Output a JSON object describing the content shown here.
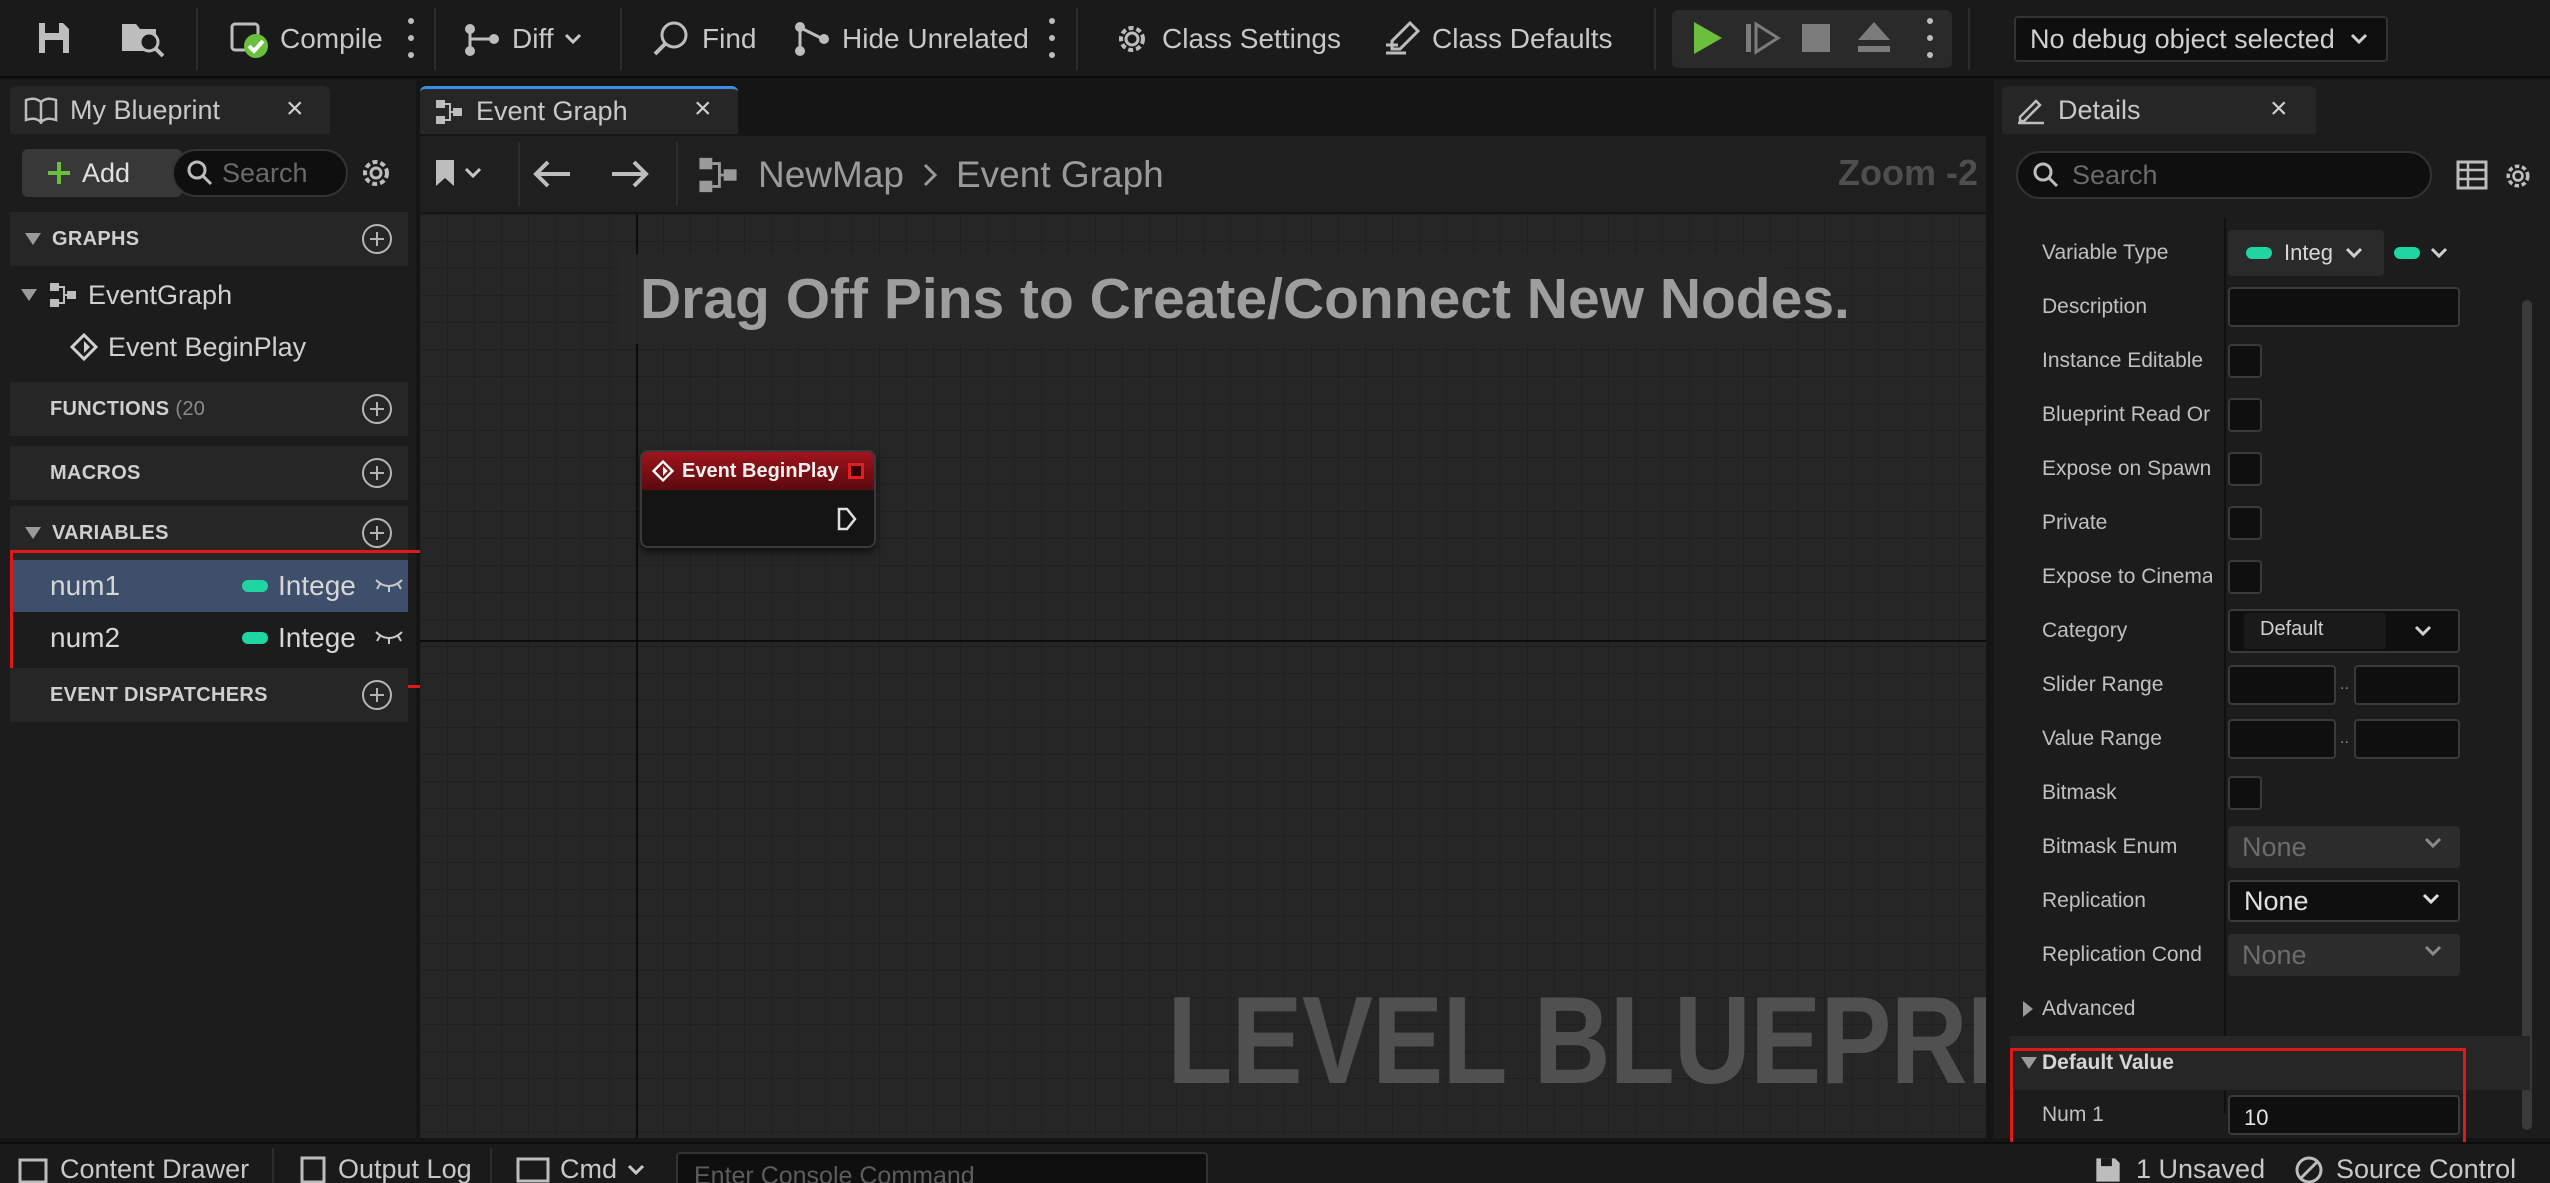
{
  "toolbar": {
    "compile_label": "Compile",
    "diff_label": "Diff",
    "find_label": "Find",
    "hide_unrelated_label": "Hide Unrelated",
    "class_settings_label": "Class Settings",
    "class_defaults_label": "Class Defaults",
    "debug_object": "No debug object selected"
  },
  "tabs": {
    "my_blueprint": "My Blueprint",
    "event_graph": "Event Graph",
    "details": "Details"
  },
  "my_blueprint": {
    "add_label": "Add",
    "search_placeholder": "Search",
    "sections": {
      "graphs": "GRAPHS",
      "functions": "FUNCTIONS",
      "functions_count": "(20",
      "macros": "MACROS",
      "variables": "VARIABLES",
      "event_dispatchers": "EVENT DISPATCHERS"
    },
    "graph_items": [
      {
        "label": "EventGraph"
      },
      {
        "label": "Event BeginPlay"
      }
    ],
    "variables": [
      {
        "name": "num1",
        "type": "Intege"
      },
      {
        "name": "num2",
        "type": "Intege"
      }
    ]
  },
  "graph": {
    "breadcrumb_root": "NewMap",
    "breadcrumb_current": "Event Graph",
    "zoom": "Zoom -2",
    "hint": "Drag Off Pins to Create/Connect New Nodes.",
    "node_title": "Event BeginPlay",
    "watermark": "LEVEL BLUEPRINT"
  },
  "details": {
    "search_placeholder": "Search",
    "variable_type_label": "Variable Type",
    "variable_type_value": "Integ",
    "description_label": "Description",
    "instance_editable_label": "Instance Editable",
    "blueprint_read_only_label": "Blueprint Read Or",
    "expose_on_spawn_label": "Expose on Spawn",
    "private_label": "Private",
    "expose_to_cinematics_label": "Expose to Cinema",
    "category_label": "Category",
    "category_value": "Default",
    "slider_range_label": "Slider Range",
    "value_range_label": "Value Range",
    "range_separator": "..",
    "bitmask_label": "Bitmask",
    "bitmask_enum_label": "Bitmask Enum",
    "bitmask_enum_value": "None",
    "replication_label": "Replication",
    "replication_value": "None",
    "replication_condition_label": "Replication Cond",
    "replication_condition_value": "None",
    "advanced_label": "Advanced",
    "default_value_header": "Default Value",
    "num1_label": "Num 1",
    "num1_value": "10"
  },
  "statusbar": {
    "content_drawer": "Content Drawer",
    "output_log": "Output Log",
    "cmd_label": "Cmd",
    "console_placeholder": "Enter Console Command",
    "unsaved": "1 Unsaved",
    "source_control": "Source Control"
  },
  "colors": {
    "accent_green": "#6abf3c",
    "pin_teal": "#1fd6a3",
    "selection_blue": "#3d4f6a",
    "highlight_red": "#e01818",
    "event_node_red": "#8a1218"
  },
  "icons": [
    "save-icon",
    "browse-icon",
    "compile-status-icon",
    "diff-icon",
    "find-icon",
    "hide-unrelated-icon",
    "class-settings-gear-icon",
    "class-defaults-icon",
    "play-icon",
    "step-icon",
    "stop-icon",
    "eject-icon",
    "blueprint-book-icon",
    "graph-icon",
    "event-icon",
    "bookmark-icon",
    "back-arrow-icon",
    "forward-arrow-icon",
    "settings-gear-icon",
    "table-view-icon",
    "eye-closed-icon",
    "exec-pin-icon"
  ]
}
